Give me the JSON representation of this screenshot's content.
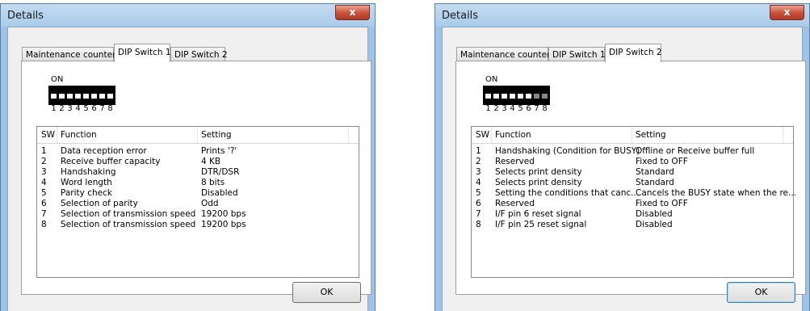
{
  "dialogs": [
    {
      "title": "Details",
      "close_label": "x",
      "tabs": [
        "Maintenance counter",
        "DIP Switch 1",
        "DIP Switch 2"
      ],
      "active_tab": 1,
      "on_label": "ON",
      "switch_numbers": [
        "1",
        "2",
        "3",
        "4",
        "5",
        "6",
        "7",
        "8"
      ],
      "switch_states": [
        "off",
        "off",
        "off",
        "off",
        "off",
        "off",
        "off",
        "off"
      ],
      "columns": [
        "SW",
        "Function",
        "Setting"
      ],
      "rows": [
        {
          "sw": "1",
          "function": "Data reception error",
          "setting": "Prints '?'"
        },
        {
          "sw": "2",
          "function": "Receive buffer capacity",
          "setting": "4 KB"
        },
        {
          "sw": "3",
          "function": "Handshaking",
          "setting": "DTR/DSR"
        },
        {
          "sw": "4",
          "function": "Word length",
          "setting": "8 bits"
        },
        {
          "sw": "5",
          "function": "Parity check",
          "setting": "Disabled"
        },
        {
          "sw": "6",
          "function": "Selection of parity",
          "setting": "Odd"
        },
        {
          "sw": "7",
          "function": "Selection of transmission speed",
          "setting": "19200 bps"
        },
        {
          "sw": "8",
          "function": "Selection of transmission speed",
          "setting": "19200 bps"
        }
      ],
      "ok_label": "OK"
    },
    {
      "title": "Details",
      "close_label": "x",
      "tabs": [
        "Maintenance counter",
        "DIP Switch 1",
        "DIP Switch 2"
      ],
      "active_tab": 2,
      "on_label": "ON",
      "switch_numbers": [
        "1",
        "2",
        "3",
        "4",
        "5",
        "6",
        "7",
        "8"
      ],
      "switch_states": [
        "off",
        "off",
        "off",
        "off",
        "off",
        "off",
        "gray",
        "gray"
      ],
      "columns": [
        "SW",
        "Function",
        "Setting"
      ],
      "rows": [
        {
          "sw": "1",
          "function": "Handshaking (Condition for BUSY)",
          "setting": "Offline or Receive buffer full"
        },
        {
          "sw": "2",
          "function": "Reserved",
          "setting": "Fixed to OFF"
        },
        {
          "sw": "3",
          "function": "Selects print density",
          "setting": "Standard"
        },
        {
          "sw": "4",
          "function": "Selects print density",
          "setting": "Standard"
        },
        {
          "sw": "5",
          "function": "Setting the conditions that canc...",
          "setting": "Cancels the BUSY state when the re..."
        },
        {
          "sw": "6",
          "function": "Reserved",
          "setting": "Fixed to OFF"
        },
        {
          "sw": "7",
          "function": "I/F pin 6 reset signal",
          "setting": "Disabled"
        },
        {
          "sw": "8",
          "function": "I/F pin 25 reset signal",
          "setting": "Disabled"
        }
      ],
      "ok_label": "OK"
    }
  ]
}
